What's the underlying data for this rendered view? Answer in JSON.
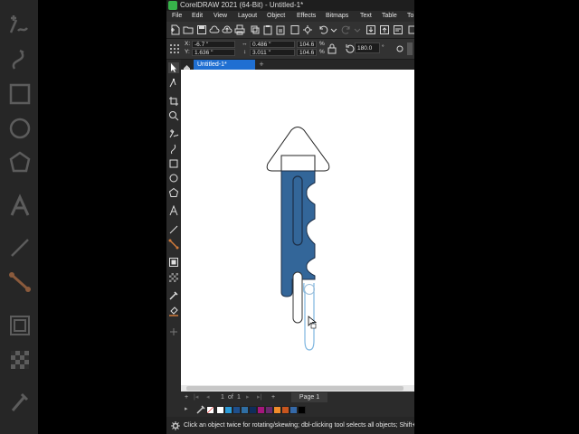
{
  "window": {
    "title": "CorelDRAW 2021 (64-Bit) - Untitled-1*"
  },
  "menu": [
    "File",
    "Edit",
    "View",
    "Layout",
    "Object",
    "Effects",
    "Bitmaps",
    "Text",
    "Table",
    "To"
  ],
  "properties": {
    "x_label": "X:",
    "x_value": "-6.7 \"",
    "y_label": "Y:",
    "y_value": "1.636 \"",
    "width_value": "0.486 \"",
    "height_value": "3.011 \"",
    "scale_x": "104.6",
    "scale_y": "104.6",
    "percent": "%",
    "rotation": "180.0",
    "rotation_unit": "°"
  },
  "document_tab": {
    "label": "Untitled-1*"
  },
  "page_nav": {
    "first": "|◂",
    "prev": "◂",
    "current": "1",
    "of": "of",
    "total": "1",
    "next": "▸",
    "last": "▸|",
    "add": "+",
    "add_left": "+",
    "page_label": "Page 1"
  },
  "palette": {
    "colors": [
      "#ffffff",
      "#2b9bd8",
      "#1e4f8c",
      "#2f6ea3",
      "#0f2d5b",
      "#a5167c",
      "#6b2a6e",
      "#f08c2b",
      "#c8551e",
      "#3569a8",
      "#000000"
    ]
  },
  "status": {
    "message": "Click an object twice for rotating/skewing; dbl-clicking tool selects all objects; Shift+cli"
  },
  "accent": "#1f6fd2",
  "shape_fill": "#336699"
}
